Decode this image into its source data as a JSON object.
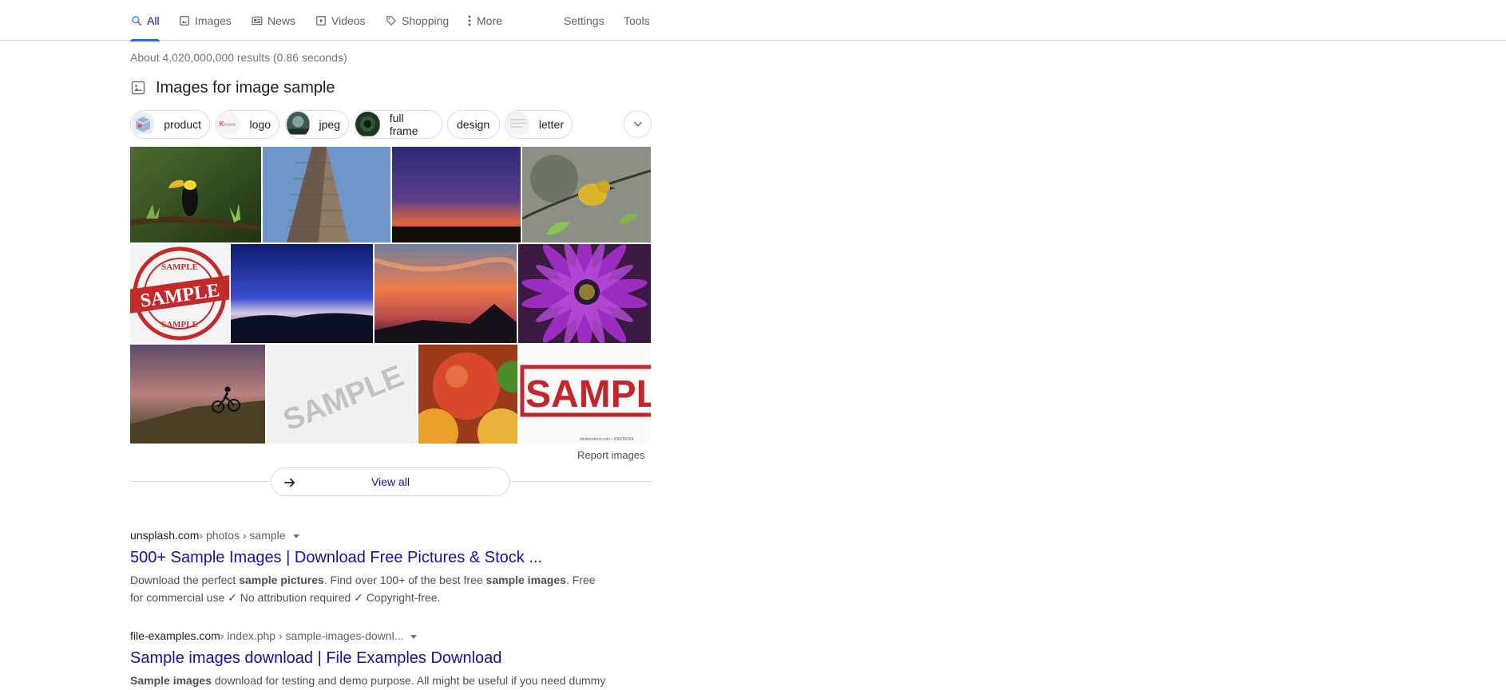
{
  "nav": {
    "tabs": [
      {
        "label": "All",
        "icon": "search-icon"
      },
      {
        "label": "Images",
        "icon": "image-icon"
      },
      {
        "label": "News",
        "icon": "news-icon"
      },
      {
        "label": "Videos",
        "icon": "video-icon"
      },
      {
        "label": "Shopping",
        "icon": "tag-icon"
      },
      {
        "label": "More",
        "icon": "more-vert-icon"
      }
    ],
    "active_tab": "All",
    "settings_label": "Settings",
    "tools_label": "Tools"
  },
  "stats": "About 4,020,000,000 results (0.86 seconds)",
  "images_section": {
    "heading": "Images for image sample",
    "chips": [
      "product",
      "logo",
      "jpeg",
      "full frame",
      "design",
      "letter"
    ],
    "chip_thumb_texts": {
      "logo": "kiwor"
    },
    "tile_texts": {
      "stamp_top": "SAMPLE",
      "stamp_mid": "SAMPLE",
      "stamp_bottom": "SAMPLE",
      "watermark": "SAMPLE",
      "red_stamp": "SAMPLE",
      "credit": "shutterstock.com • 336256268"
    },
    "report_label": "Report images",
    "view_all_label": "View all"
  },
  "results": [
    {
      "domain": "unsplash.com",
      "path": " › photos › sample",
      "title": "500+ Sample Images | Download Free Pictures & Stock ...",
      "snippet_parts": [
        {
          "t": "Download the perfect ",
          "b": false
        },
        {
          "t": "sample pictures",
          "b": true
        },
        {
          "t": ". Find over 100+ of the best free ",
          "b": false
        },
        {
          "t": "sample images",
          "b": true
        },
        {
          "t": ". Free for commercial use ✓ No attribution required ✓ Copyright-free.",
          "b": false
        }
      ]
    },
    {
      "domain": "file-examples.com",
      "path": " › index.php › sample-images-downl...",
      "title": "Sample images download | File Examples Download",
      "snippet_parts": [
        {
          "t": "Sample images",
          "b": true
        },
        {
          "t": " download for testing and demo purpose. All might be useful if you need dummy",
          "b": false
        }
      ]
    }
  ],
  "colors": {
    "link": "#1a0dab",
    "accent": "#1a73e8",
    "meta": "#70757a"
  }
}
